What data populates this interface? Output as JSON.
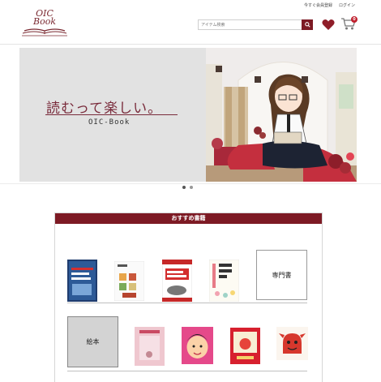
{
  "header": {
    "links": [
      "今すぐ会員登録",
      "ログイン"
    ],
    "logo_line1": "OIC",
    "logo_line2": "Book",
    "search_placeholder": "アイテム検索",
    "cart_count": "0"
  },
  "hero": {
    "title": "読むって楽しい。",
    "subtitle": "OIC-Book"
  },
  "recommended": {
    "heading": "おすすめ書籍",
    "category_tiles": [
      "専門書",
      "絵本"
    ]
  },
  "colors": {
    "brand": "#7d1a24",
    "badge": "#c0202e"
  },
  "icons": [
    "search-icon",
    "heart-icon",
    "cart-icon"
  ]
}
